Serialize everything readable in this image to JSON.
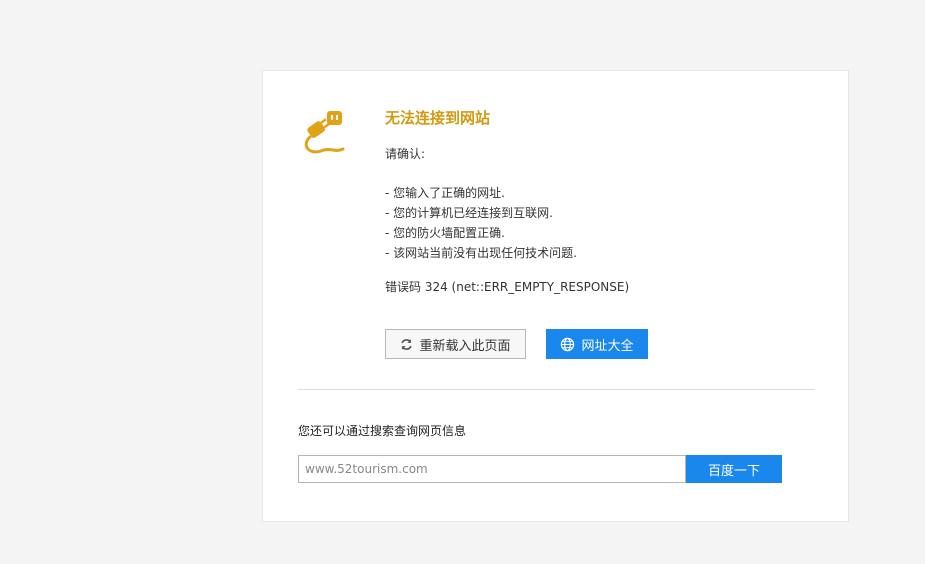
{
  "error_page": {
    "title": "无法连接到网站",
    "confirm_heading": "请确认:",
    "checklist": [
      "- 您输入了正确的网址.",
      "- 您的计算机已经连接到互联网.",
      "- 您的防火墙配置正确.",
      "- 该网站当前没有出现任何技术问题."
    ],
    "error_code": "错误码 324 (net::ERR_EMPTY_RESPONSE)",
    "icon": "unplugged-cable-icon",
    "accent_color": "#d29a10"
  },
  "actions": {
    "reload_label": "重新载入此页面",
    "reload_icon": "refresh-icon",
    "sites_label": "网址大全",
    "sites_icon": "globe-icon",
    "primary_color": "#1a87ec"
  },
  "search": {
    "hint": "您还可以通过搜索查询网页信息",
    "value": "www.52tourism.com",
    "button_label": "百度一下"
  }
}
